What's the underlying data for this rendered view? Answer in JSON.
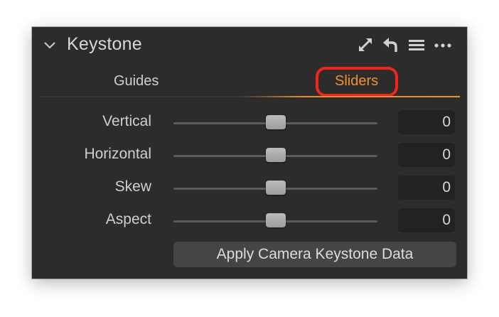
{
  "panel": {
    "title": "Keystone",
    "header_icons": [
      "expand-icon",
      "reset-icon",
      "menu-icon",
      "more-icon"
    ]
  },
  "tabs": [
    {
      "label": "Guides",
      "active": false
    },
    {
      "label": "Sliders",
      "active": true
    }
  ],
  "sliders": [
    {
      "label": "Vertical",
      "value": "0",
      "level": 0.5
    },
    {
      "label": "Horizontal",
      "value": "0",
      "level": 0.5
    },
    {
      "label": "Skew",
      "value": "0",
      "level": 0.5
    },
    {
      "label": "Aspect",
      "value": "0",
      "level": 0.5
    }
  ],
  "apply_button": {
    "label": "Apply Camera Keystone Data"
  },
  "colors": {
    "panel_bg": "#2c2c2c",
    "accent": "#f0922e",
    "highlight": "#f2251a",
    "text": "#cfcfcf"
  }
}
